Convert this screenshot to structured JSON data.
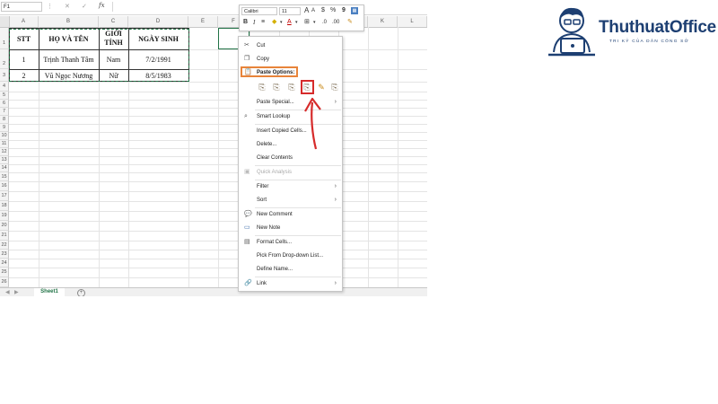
{
  "formula_bar": {
    "name_box": "F1",
    "cancel_icon": "✕",
    "enter_icon": "✓",
    "fx_label": "fx",
    "value": ""
  },
  "columns": [
    "A",
    "B",
    "C",
    "D",
    "E",
    "F",
    "G",
    "H",
    "I",
    "J",
    "K",
    "L"
  ],
  "rows": [
    "1",
    "2",
    "3",
    "4",
    "5",
    "6",
    "7",
    "8",
    "9",
    "10",
    "11",
    "12",
    "13",
    "14",
    "15",
    "16",
    "17",
    "18",
    "19",
    "20",
    "21",
    "22",
    "23",
    "24",
    "25",
    "26"
  ],
  "table": {
    "headers": [
      "STT",
      "HỌ VÀ TÊN",
      "GIỚI TÍNH",
      "NGÀY SINH"
    ],
    "rows": [
      [
        "1",
        "Trịnh Thanh Tâm",
        "Nam",
        "7/2/1991"
      ],
      [
        "2",
        "Vũ Ngọc Nương",
        "Nữ",
        "8/5/1983"
      ]
    ]
  },
  "mini_toolbar": {
    "font_name": "Calibri",
    "font_size": "11",
    "increase_font": "A",
    "decrease_font": "A",
    "bold": "B",
    "italic": "I",
    "currency": "$",
    "percent": "%",
    "comma": "9"
  },
  "context_menu": {
    "items": [
      {
        "label": "Cut",
        "icon": "scissors-icon"
      },
      {
        "label": "Copy",
        "icon": "copy-icon"
      },
      {
        "label": "Paste Options:",
        "icon": "paste-icon"
      },
      {
        "label": "Paste Special...",
        "submenu": true
      },
      {
        "label": "Smart Lookup",
        "icon": "search-icon"
      },
      {
        "label": "Insert Copied Cells..."
      },
      {
        "label": "Delete..."
      },
      {
        "label": "Clear Contents"
      },
      {
        "label": "Quick Analysis",
        "icon": "quick-analysis-icon",
        "disabled": true
      },
      {
        "label": "Filter",
        "submenu": true
      },
      {
        "label": "Sort",
        "submenu": true
      },
      {
        "label": "New Comment",
        "icon": "comment-icon"
      },
      {
        "label": "New Note",
        "icon": "note-icon"
      },
      {
        "label": "Format Cells...",
        "icon": "format-cells-icon"
      },
      {
        "label": "Pick From Drop-down List..."
      },
      {
        "label": "Define Name..."
      },
      {
        "label": "Link",
        "icon": "link-icon",
        "submenu": true
      }
    ],
    "paste_icons": [
      "paste-icon",
      "paste-values-icon",
      "paste-formulas-icon",
      "paste-transpose-icon",
      "paste-formatting-icon",
      "paste-link-icon"
    ]
  },
  "sheet_tabs": {
    "active": "Sheet1",
    "add_icon": "+"
  },
  "logo": {
    "name": "ThuthuatOffice",
    "tagline": "TRI KỶ CỦA DÂN CÔNG SỞ"
  },
  "colors": {
    "excel_green": "#217346",
    "paste_highlight": "#e8843a",
    "annotation_red": "#d62b2b",
    "logo_blue": "#1d3f72"
  }
}
